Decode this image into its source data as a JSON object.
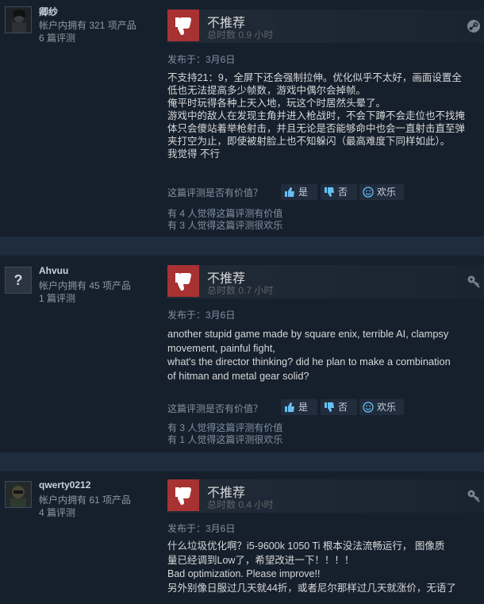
{
  "reviews": [
    {
      "user": {
        "name": "卿纱",
        "products": "帐户内拥有 321 项产品",
        "reviews": "6 篇评测"
      },
      "recommendation": "不推荐",
      "hours": "总时数 0.9 小时",
      "posted": "发布于：3月6日",
      "lines": [
        "不支持21：9，全屏下还会强制拉伸。优化似乎不太好，画面设置全",
        "低也无法提高多少帧数，游戏中偶尔会掉帧。",
        "俺平时玩得各种上天入地，玩这个时居然头晕了。",
        "游戏中的敌人在发现主角并进入枪战时，不会下蹲不会走位也不找掩",
        "体只会傻站着举枪射击，并且无论是否能够命中也会一直射击直至弹",
        "夹打空为止，即使被射脸上也不知躲闪（最高难度下同样如此）。",
        "我觉得 不行"
      ],
      "helpful_q": "这篇评测是否有价值？",
      "btn_yes": "是",
      "btn_no": "否",
      "btn_funny": "欢乐",
      "stat_helpful": "有 4 人觉得这篇评测有价值",
      "stat_funny": "有 3 人觉得这篇评测很欢乐"
    },
    {
      "user": {
        "name": "Ahvuu",
        "products": "帐户内拥有 45 项产品",
        "reviews": "1 篇评测"
      },
      "recommendation": "不推荐",
      "hours": "总时数 0.7 小时",
      "posted": "发布于：3月6日",
      "lines": [
        "another stupid game made by square enix, terrible AI, clampsy",
        "movement, painful fight,",
        "what's the director thinking? did he plan to make a combination",
        "of hitman and metal gear solid?"
      ],
      "helpful_q": "这篇评测是否有价值？",
      "btn_yes": "是",
      "btn_no": "否",
      "btn_funny": "欢乐",
      "stat_helpful": "有 3 人觉得这篇评测有价值",
      "stat_funny": "有 1 人觉得这篇评测很欢乐"
    },
    {
      "user": {
        "name": "qwerty0212",
        "products": "帐户内拥有 61 项产品",
        "reviews": "4 篇评测"
      },
      "recommendation": "不推荐",
      "hours": "总时数 0.4 小时",
      "posted": "发布于：3月6日",
      "lines": [
        "什么垃圾优化啊？i5-9600k 1050 Ti 根本没法流畅运行， 图像质",
        "量已经调到Low了，希望改进一下！！！！",
        "Bad optimization. Please improve!!",
        "另外别像日服过几天就44折，或者尼尔那样过几天就涨价，无语了"
      ]
    }
  ],
  "icons": {
    "avatar_unknown": "?",
    "thumb": "thumbs-down",
    "corner_1": "steam-logo",
    "corner_2": "key-icon"
  },
  "colors": {
    "thumb_bg": "#a83232",
    "link": "#66c0f4"
  }
}
